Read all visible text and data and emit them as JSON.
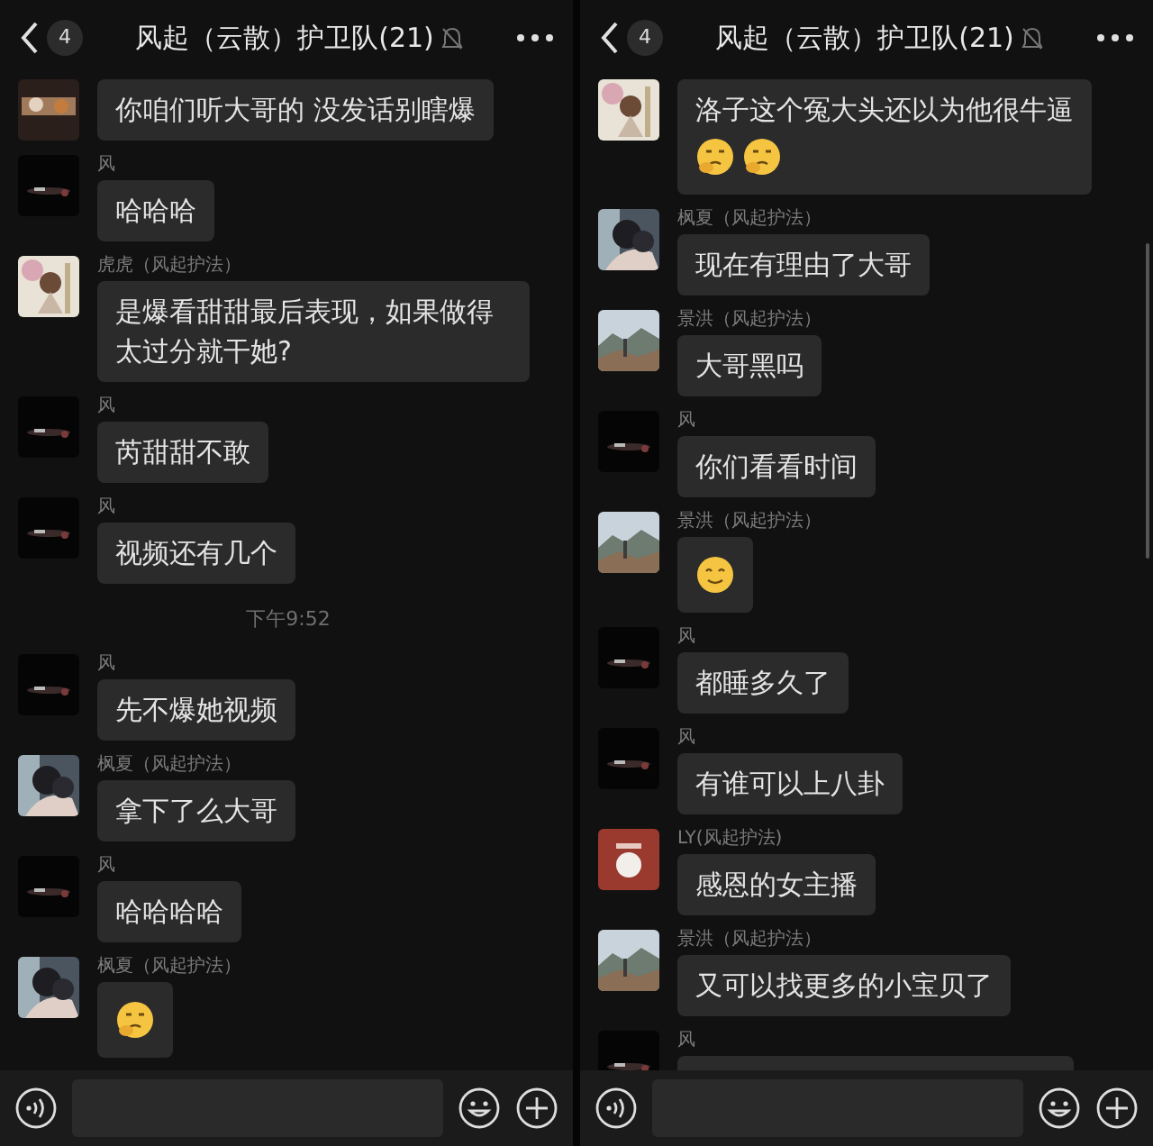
{
  "panels": [
    {
      "header": {
        "unread": "4",
        "title": "风起（云散）护卫队(21)",
        "muted": true
      },
      "scrollbar": false,
      "messages": [
        {
          "kind": "text",
          "avatar": {
            "kind": "figures"
          },
          "text": "你咱们听大哥的 没发话别瞎爆"
        },
        {
          "kind": "text",
          "sender": "风",
          "avatar": {
            "kind": "night"
          },
          "text": "哈哈哈"
        },
        {
          "kind": "text",
          "sender": "虎虎（风起护法）",
          "avatar": {
            "kind": "doll"
          },
          "text": "是爆看甜甜最后表现，如果做得太过分就干她?"
        },
        {
          "kind": "text",
          "sender": "风",
          "avatar": {
            "kind": "night"
          },
          "text": "芮甜甜不敢"
        },
        {
          "kind": "text",
          "sender": "风",
          "avatar": {
            "kind": "night"
          },
          "text": "视频还有几个"
        },
        {
          "kind": "time",
          "text": "下午9:52"
        },
        {
          "kind": "text",
          "sender": "风",
          "avatar": {
            "kind": "night"
          },
          "text": "先不爆她视频"
        },
        {
          "kind": "text",
          "sender": "枫夏（风起护法）",
          "avatar": {
            "kind": "couple"
          },
          "text": "拿下了么大哥"
        },
        {
          "kind": "text",
          "sender": "风",
          "avatar": {
            "kind": "night"
          },
          "text": "哈哈哈哈"
        },
        {
          "kind": "text",
          "sender": "枫夏（风起护法）",
          "avatar": {
            "kind": "couple"
          },
          "emojis": [
            {
              "kind": "thinking"
            }
          ]
        }
      ]
    },
    {
      "header": {
        "unread": "4",
        "title": "风起（云散）护卫队(21)",
        "muted": true
      },
      "scrollbar": true,
      "messages": [
        {
          "kind": "text",
          "avatar": {
            "kind": "doll"
          },
          "text": "洛子这个冤大头还以为他很牛逼",
          "emojis": [
            {
              "kind": "thinking"
            },
            {
              "kind": "thinking"
            }
          ]
        },
        {
          "kind": "text",
          "sender": "枫夏（风起护法）",
          "avatar": {
            "kind": "couple"
          },
          "text": "现在有理由了大哥"
        },
        {
          "kind": "text",
          "sender": "景洪（风起护法）",
          "avatar": {
            "kind": "landscape"
          },
          "text": "大哥黑吗"
        },
        {
          "kind": "text",
          "sender": "风",
          "avatar": {
            "kind": "night"
          },
          "text": "你们看看时间"
        },
        {
          "kind": "text",
          "sender": "景洪（风起护法）",
          "avatar": {
            "kind": "landscape"
          },
          "emojis": [
            {
              "kind": "smile"
            }
          ]
        },
        {
          "kind": "text",
          "sender": "风",
          "avatar": {
            "kind": "night"
          },
          "text": "都睡多久了"
        },
        {
          "kind": "text",
          "sender": "风",
          "avatar": {
            "kind": "night"
          },
          "text": "有谁可以上八卦"
        },
        {
          "kind": "text",
          "sender": "LY(风起护法)",
          "avatar": {
            "kind": "red"
          },
          "text": "感恩的女主播"
        },
        {
          "kind": "text",
          "sender": "景洪（风起护法）",
          "avatar": {
            "kind": "landscape"
          },
          "text": "又可以找更多的小宝贝了"
        },
        {
          "kind": "cut",
          "sender": "风",
          "avatar": {
            "kind": "night"
          }
        }
      ]
    }
  ]
}
